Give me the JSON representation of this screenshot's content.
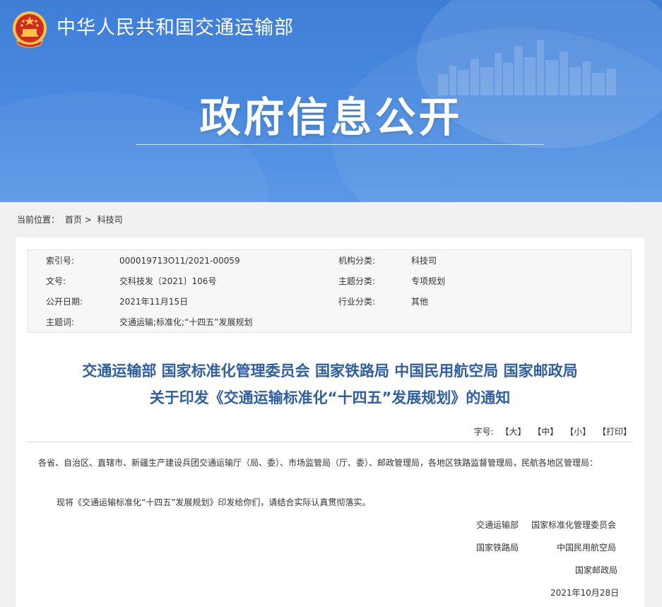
{
  "header": {
    "ministry_name": "中华人民共和国交通运输部",
    "section_title": "政府信息公开",
    "colors": {
      "banner": "#4a8ae0",
      "title_blue": "#2e5fa2",
      "emblem_red": "#d22a1e",
      "emblem_gold": "#f7c54a"
    },
    "emblem_icon": "national-emblem-icon"
  },
  "breadcrumb": {
    "prefix": "当前位置：",
    "home": "首页",
    "separator": ">",
    "current": "科技司"
  },
  "meta": {
    "index_label": "索引号:",
    "index_value": "000019713O11/2021-00059",
    "org_label": "机构分类:",
    "org_value": "科技司",
    "doc_no_label": "文号:",
    "doc_no_value": "交科技发〔2021〕106号",
    "topic_label": "主题分类:",
    "topic_value": "专项规划",
    "date_label": "公开日期:",
    "date_value": "2021年11月15日",
    "industry_label": "行业分类:",
    "industry_value": "其他",
    "keywords_label": "主题词:",
    "keywords_value": "交通运输;标准化;“十四五”发展规划"
  },
  "document": {
    "title_line1": "交通运输部 国家标准化管理委员会 国家铁路局 中国民用航空局 国家邮政局",
    "title_line2": "关于印发《交通运输标准化“十四五”发展规划》的通知",
    "font_size_label": "字号:",
    "font_large": "【大】",
    "font_medium": "【中】",
    "font_small": "【小】",
    "print": "【打印】",
    "recipients": "各省、自治区、直辖市、新疆生产建设兵团交通运输厅（局、委）、市场监管局（厅、委）、邮政管理局，各地区铁路监督管理局，民航各地区管理局：",
    "body": "现将《交通运输标准化“十四五”发展规划》印发给你们，请结合实际认真贯彻落实。",
    "signatories": {
      "moT": "交通运输部",
      "sac": "国家标准化管理委员会",
      "nra": "国家铁路局",
      "caac": "中国民用航空局",
      "spb": "国家邮政局"
    },
    "signed_date": "2021年10月28日"
  }
}
